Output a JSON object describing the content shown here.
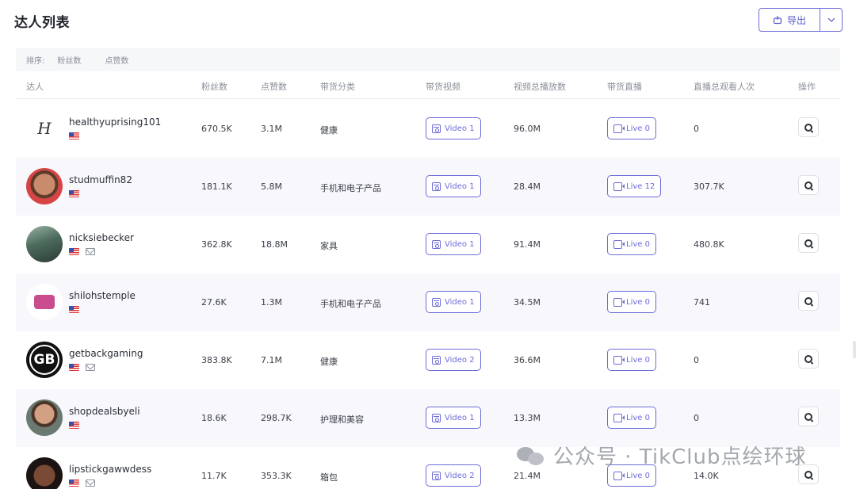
{
  "page": {
    "title": "达人列表"
  },
  "toolbar": {
    "export_label": "导出"
  },
  "sort": {
    "label": "排序:",
    "options": [
      "粉丝数",
      "点赞数"
    ]
  },
  "table": {
    "headers": [
      "达人",
      "粉丝数",
      "点赞数",
      "带货分类",
      "带货视频",
      "视频总播放数",
      "带货直播",
      "直播总观看人次",
      "操作"
    ],
    "rows": [
      {
        "name": "healthyuprising101",
        "mail": false,
        "followers": "670.5K",
        "likes": "3.1M",
        "category": "健康",
        "video": "Video 1",
        "views": "96.0M",
        "live": "Live 0",
        "live_views": "0",
        "avatar": "logo-healthy"
      },
      {
        "name": "studmuffin82",
        "mail": false,
        "followers": "181.1K",
        "likes": "5.8M",
        "category": "手机和电子产品",
        "video": "Video 1",
        "views": "28.4M",
        "live": "Live 12",
        "live_views": "307.7K",
        "avatar": "photo-red"
      },
      {
        "name": "nicksiebecker",
        "mail": true,
        "followers": "362.8K",
        "likes": "18.8M",
        "category": "家具",
        "video": "Video 1",
        "views": "91.4M",
        "live": "Live 0",
        "live_views": "480.8K",
        "avatar": "photo-outdoor"
      },
      {
        "name": "shilohstemple",
        "mail": false,
        "followers": "27.6K",
        "likes": "1.3M",
        "category": "手机和电子产品",
        "video": "Video 1",
        "views": "34.5M",
        "live": "Live 0",
        "live_views": "741",
        "avatar": "logo-pink"
      },
      {
        "name": "getbackgaming",
        "mail": true,
        "followers": "383.8K",
        "likes": "7.1M",
        "category": "健康",
        "video": "Video 2",
        "views": "36.6M",
        "live": "Live 0",
        "live_views": "0",
        "avatar": "logo-gb"
      },
      {
        "name": "shopdealsbyeli",
        "mail": false,
        "followers": "18.6K",
        "likes": "298.7K",
        "category": "护理和美容",
        "video": "Video 1",
        "views": "13.3M",
        "live": "Live 0",
        "live_views": "0",
        "avatar": "photo-man"
      },
      {
        "name": "lipstickgawwdess",
        "mail": true,
        "followers": "11.7K",
        "likes": "353.3K",
        "category": "箱包",
        "video": "Video 2",
        "views": "21.4M",
        "live": "Live 0",
        "live_views": "14.0K",
        "avatar": "photo-woman"
      }
    ]
  },
  "watermark": {
    "text": "公众号 · TikClub点绘环球"
  },
  "colors": {
    "accent": "#6d6bd8",
    "row_alt": "#f8f8fc",
    "text": "#3a3e47",
    "muted": "#8a8f99"
  },
  "icons": {
    "export": "export-icon",
    "dropdown": "chevron-down-icon",
    "video": "video-calendar-icon",
    "live": "live-camera-icon",
    "operate": "search-icon",
    "flag": "us-flag-icon",
    "mail": "mail-icon",
    "watermark": "wechat-icon"
  }
}
